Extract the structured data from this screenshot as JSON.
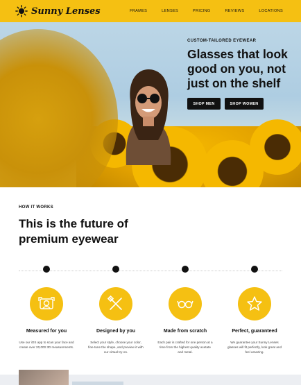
{
  "brand": {
    "name": "Sunny Lenses",
    "logo_icon": "sun-icon",
    "accent": "#f5c012"
  },
  "nav": {
    "items": [
      "FRAMES",
      "LENSES",
      "PRICING",
      "REVIEWS",
      "LOCATIONS"
    ]
  },
  "hero": {
    "eyebrow": "CUSTOM-TAILORED EYEWEAR",
    "title": "Glasses that look good on you, not just on the shelf",
    "buttons": {
      "men": "SHOP MEN",
      "women": "SHOP WOMEN"
    }
  },
  "how": {
    "kicker": "HOW IT WORKS",
    "title": "This is the future of premium eyewear",
    "steps": [
      {
        "icon": "scan-face-icon",
        "title": "Measured for you",
        "desc": "Use our iOS app to scan your face and create over 20,000 3D measurements."
      },
      {
        "icon": "design-tools-icon",
        "title": "Designed by you",
        "desc": "Select your style, choose your color, fine-tune the shape, and preview it with our virtual try-on."
      },
      {
        "icon": "glasses-icon",
        "title": "Made from scratch",
        "desc": "Each pair is crafted for one person at a time from the highest quality acetate and metal."
      },
      {
        "icon": "star-badge-icon",
        "title": "Perfect, guaranteed",
        "desc": "We guarantee your Sunny Lenses glasses will fit perfectly, look great and feel amazing."
      }
    ]
  }
}
